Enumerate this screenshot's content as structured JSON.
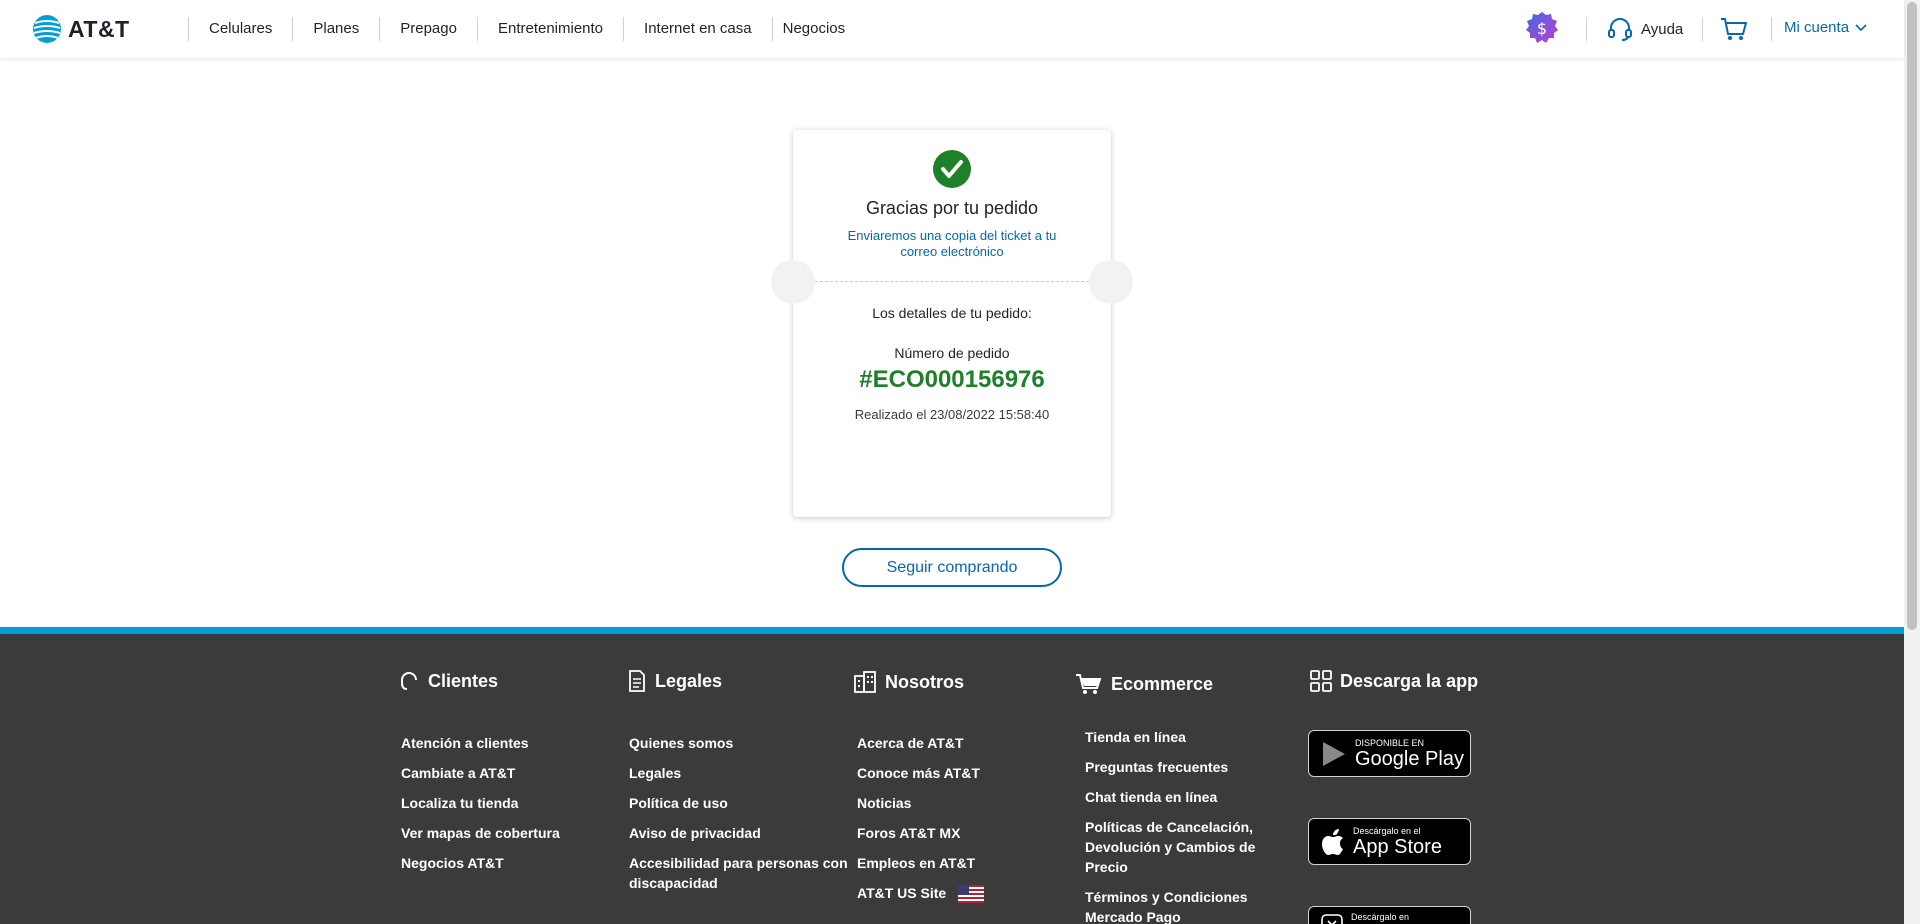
{
  "header": {
    "logo_text": "AT&T",
    "nav": [
      "Celulares",
      "Planes",
      "Prepago",
      "Entretenimiento",
      "Internet en casa",
      "Negocios"
    ],
    "help_label": "Ayuda",
    "account_label": "Mi cuenta"
  },
  "order": {
    "title": "Gracias por tu pedido",
    "subtitle": "Enviaremos una copia del ticket a tu correo electrónico",
    "details_label": "Los detalles de tu pedido:",
    "number_label": "Número de pedido",
    "number": "#ECO000156976",
    "date": "Realizado el 23/08/2022 15:58:40"
  },
  "continue_label": "Seguir comprando",
  "footer": {
    "clientes": {
      "title": "Clientes",
      "items": [
        "Atención a clientes",
        "Cambiate a AT&T",
        "Localiza tu tienda",
        "Ver mapas de cobertura",
        "Negocios AT&T"
      ]
    },
    "legales": {
      "title": "Legales",
      "items": [
        "Quienes somos",
        "Legales",
        "Política de uso",
        "Aviso de privacidad",
        "Accesibilidad para personas con discapacidad"
      ]
    },
    "nosotros": {
      "title": "Nosotros",
      "items": [
        "Acerca de AT&T",
        "Conoce más AT&T",
        "Noticias",
        "Foros AT&T MX",
        "Empleos en AT&T",
        "AT&T US Site"
      ]
    },
    "ecommerce": {
      "title": "Ecommerce",
      "items": [
        "Tienda en línea",
        "Preguntas frecuentes",
        "Chat tienda en línea",
        "Políticas de Cancelación, Devolución y Cambios de Precio",
        "Términos y Condiciones Mercado Pago"
      ]
    },
    "app": {
      "title": "Descarga la app",
      "google_small": "DISPONIBLE EN",
      "google_big": "Google Play",
      "apple_small": "Descárgalo en el",
      "apple_big": "App Store",
      "third_small": "Descárgalo en"
    }
  },
  "colors": {
    "brand_blue": "#0568ae",
    "success_green": "#1e8029",
    "footer_bg": "#3b3b3b",
    "footer_accent": "#009fdb"
  }
}
